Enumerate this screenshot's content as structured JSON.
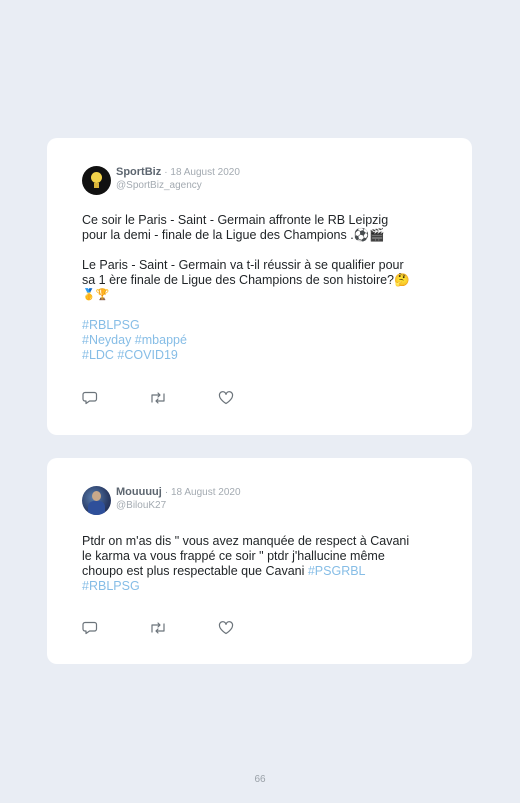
{
  "tweets": [
    {
      "name": "SportBiz",
      "date": "· 18 August 2020",
      "handle": "@SportBiz_agency",
      "avatar_icon": "trophy-avatar",
      "line1": "Ce soir le Paris - Saint - Germain affronte le RB Leipzig",
      "line2": "pour la demi - finale de la Ligue des Champions .⚽🎬",
      "line3": "Le Paris - Saint - Germain va t-il réussir à se qualifier pour",
      "line4": "sa 1 ère finale de Ligue des Champions de son histoire?🤔",
      "line5": "🥇🏆",
      "tag1": "#RBLPSG",
      "tag2": "#Neyday #mbappé",
      "tag3": "#LDC #COVID19"
    },
    {
      "name": "Mouuuuj",
      "date": "· 18 August 2020",
      "handle": "@BilouK27",
      "avatar_icon": "profile-photo-avatar",
      "line1": "Ptdr on m'as dis \" vous avez manquée de respect à Cavani",
      "line2": "le karma va vous frappé ce soir \" ptdr j'hallucine même",
      "line3": "choupo est plus respectable que Cavani ",
      "tag_inline": "#PSGRBL",
      "tag4": "#RBLPSG"
    }
  ],
  "actions": [
    "reply-icon",
    "retweet-icon",
    "like-icon"
  ],
  "colors": {
    "background": "#e9edf4",
    "card": "#ffffff",
    "hashtag": "#86bde6",
    "muted": "#a3aab1"
  },
  "page_number": "66"
}
